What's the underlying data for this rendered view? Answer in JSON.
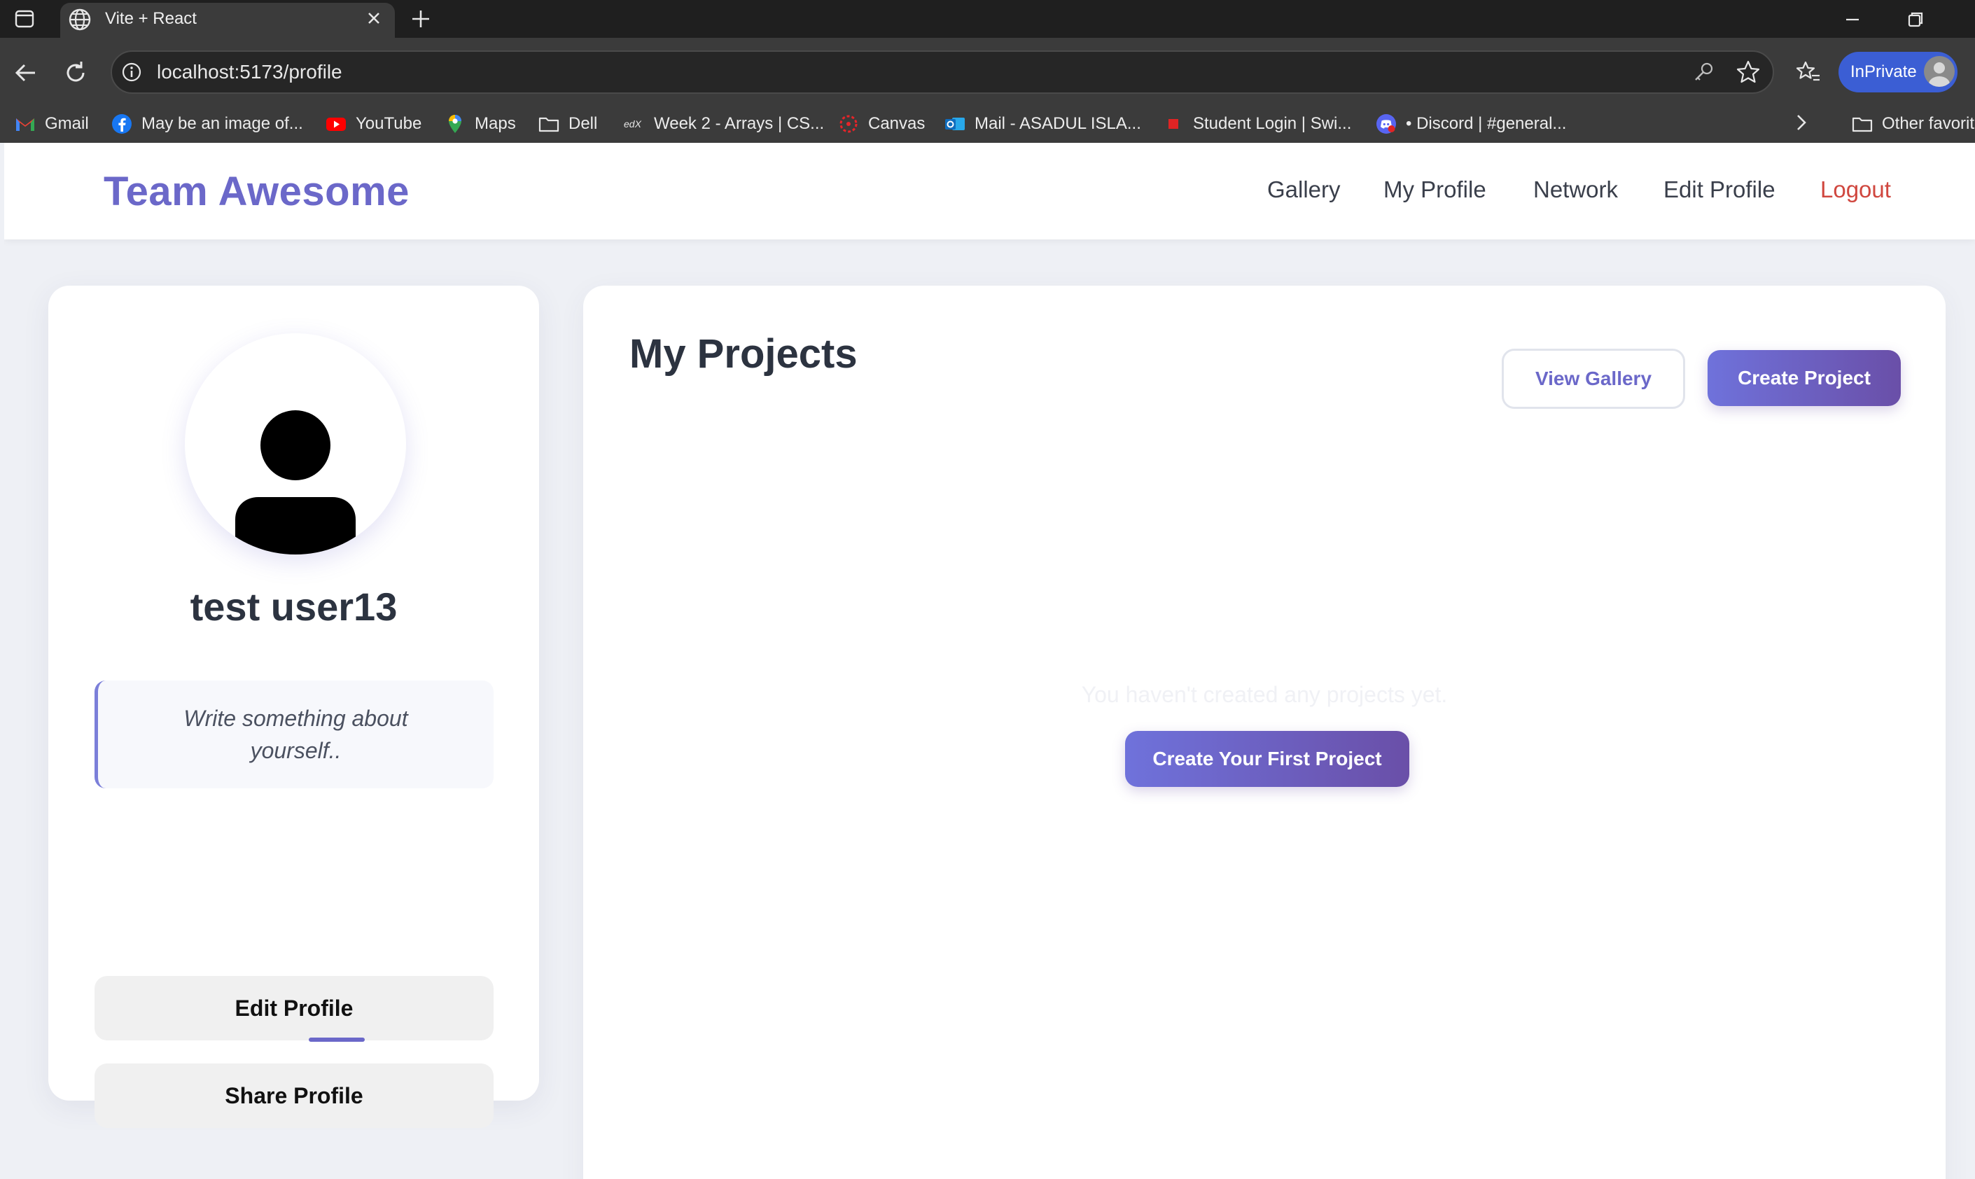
{
  "browser": {
    "tab_title": "Vite + React",
    "url": "localhost:5173/profile",
    "inprivate_label": "InPrivate",
    "bookmarks": [
      {
        "label": "Gmail",
        "icon": "gmail-icon"
      },
      {
        "label": "May be an image of...",
        "icon": "facebook-icon"
      },
      {
        "label": "YouTube",
        "icon": "youtube-icon"
      },
      {
        "label": "Maps",
        "icon": "maps-icon"
      },
      {
        "label": "Dell",
        "icon": "folder-icon"
      },
      {
        "label": "Week 2 - Arrays | CS...",
        "icon": "edx-icon"
      },
      {
        "label": "Canvas",
        "icon": "canvas-icon"
      },
      {
        "label": "Mail - ASADUL ISLA...",
        "icon": "outlook-icon"
      },
      {
        "label": "Student Login | Swi...",
        "icon": "red-square-icon"
      },
      {
        "label": "• Discord | #general...",
        "icon": "discord-icon"
      }
    ],
    "other_favorites": "Other favorites"
  },
  "nav": {
    "brand": "Team Awesome",
    "links": {
      "gallery": "Gallery",
      "my_profile": "My Profile",
      "network": "Network",
      "edit_profile": "Edit Profile",
      "logout": "Logout"
    }
  },
  "profile": {
    "username": "test user13",
    "bio_placeholder": "Write something about yourself..",
    "edit_button": "Edit Profile",
    "share_button": "Share Profile"
  },
  "projects": {
    "title": "My Projects",
    "view_gallery": "View Gallery",
    "create_project": "Create Project",
    "empty_message": "You haven't created any projects yet.",
    "create_first": "Create Your First Project"
  },
  "colors": {
    "brand": "#6b68c9",
    "logout": "#d0473f",
    "gradient_start": "#6f72db",
    "gradient_end": "#6a4fa8",
    "inprivate": "#3b5ed4"
  }
}
